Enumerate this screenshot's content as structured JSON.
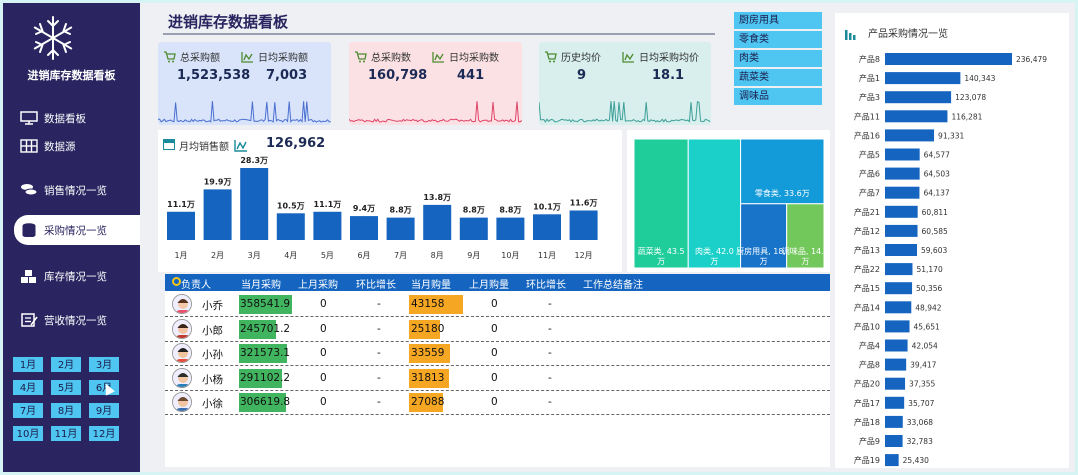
{
  "app": {
    "name": "进销库存数据看板",
    "title": "进销库存数据看板"
  },
  "sidebar": {
    "items": [
      {
        "label": "数据看板",
        "icon": "monitor-icon"
      },
      {
        "label": "数据源",
        "icon": "table-grid-icon"
      },
      {
        "label": "销售情况一览",
        "icon": "coins-icon"
      },
      {
        "label": "采购情况一览",
        "icon": "database-icon",
        "active": true
      },
      {
        "label": "库存情况一览",
        "icon": "boxes-icon"
      },
      {
        "label": "营收情况一览",
        "icon": "notepad-icon"
      }
    ],
    "months": [
      "1月",
      "2月",
      "3月",
      "4月",
      "5月",
      "6月",
      "7月",
      "8月",
      "9月",
      "10月",
      "11月",
      "12月"
    ]
  },
  "kpis": [
    {
      "label1": "总采购额",
      "value1": "1,523,538",
      "label2": "日均采购额",
      "value2": "7,003",
      "bg": "#d9e4fb",
      "spark": "#4a6fd0"
    },
    {
      "label1": "总采购数",
      "value1": "160,798",
      "label2": "日均采购数",
      "value2": "441",
      "bg": "#fbe1e4",
      "spark": "#e0446a"
    },
    {
      "label1": "历史均价",
      "value1": "9",
      "label2": "日均采购均价",
      "value2": "18.1",
      "bg": "#d8efed",
      "spark": "#3e9f99"
    }
  ],
  "categories": [
    "厨房用具",
    "零食类",
    "肉类",
    "蔬菜类",
    "调味品"
  ],
  "monthly": {
    "label": "月均销售额",
    "value": "126,962",
    "chart_data": {
      "type": "bar",
      "categories": [
        "1月",
        "2月",
        "3月",
        "4月",
        "5月",
        "6月",
        "7月",
        "8月",
        "9月",
        "10月",
        "11月",
        "12月"
      ],
      "values": [
        11.1,
        19.9,
        28.3,
        10.5,
        11.1,
        9.4,
        8.8,
        13.8,
        8.8,
        8.8,
        10.1,
        11.6
      ],
      "data_labels": [
        "11.1万",
        "19.9万",
        "28.3万",
        "10.5万",
        "11.1万",
        "9.4万",
        "8.8万",
        "13.8万",
        "8.8万",
        "8.8万",
        "10.1万",
        "11.6万"
      ],
      "color": "#1565c0"
    }
  },
  "treemap": {
    "chart_data": {
      "type": "treemap",
      "items": [
        {
          "name": "蔬菜类",
          "value": 43.5,
          "label": "蔬菜类, 43.5万",
          "color": "#1fcd9b"
        },
        {
          "name": "肉类",
          "value": 42.0,
          "label": "肉类, 42.0万",
          "color": "#1ad0c8"
        },
        {
          "name": "零食类",
          "value": 33.6,
          "label": "零食类, 33.6万",
          "color": "#139ad8"
        },
        {
          "name": "厨房用具",
          "value": 18.4,
          "label": "厨房用具, 18.4万",
          "color": "#1774c9"
        },
        {
          "name": "调味品",
          "value": 14.9,
          "label": "调味品, 14.9万",
          "color": "#72c85a"
        }
      ]
    }
  },
  "table": {
    "headers": [
      "负责人",
      "当月采购",
      "上月采购",
      "环比增长",
      "当月购量",
      "上月购量",
      "环比增长",
      "工作总结备注"
    ],
    "rows": [
      {
        "name": "小乔",
        "cur": "358541.9",
        "prev": "0",
        "growth": "-",
        "qty": "43158",
        "prevqty": "0",
        "qgrowth": "-",
        "g": 0.34,
        "o": 0.3
      },
      {
        "name": "小郎",
        "cur": "245701.2",
        "prev": "0",
        "growth": "-",
        "qty": "25180",
        "prevqty": "0",
        "qgrowth": "-",
        "g": 0.24,
        "o": 0.17
      },
      {
        "name": "小孙",
        "cur": "321573.1",
        "prev": "0",
        "growth": "-",
        "qty": "33559",
        "prevqty": "0",
        "qgrowth": "-",
        "g": 0.31,
        "o": 0.23
      },
      {
        "name": "小杨",
        "cur": "291102.2",
        "prev": "0",
        "growth": "-",
        "qty": "31813",
        "prevqty": "0",
        "qgrowth": "-",
        "g": 0.28,
        "o": 0.22
      },
      {
        "name": "小徐",
        "cur": "306619.8",
        "prev": "0",
        "growth": "-",
        "qty": "27088",
        "prevqty": "0",
        "qgrowth": "-",
        "g": 0.3,
        "o": 0.19
      }
    ]
  },
  "products": {
    "title": "产品采购情况一览",
    "chart_data": {
      "type": "bar",
      "orientation": "horizontal",
      "categories": [
        "产品8",
        "产品1",
        "产品3",
        "产品11",
        "产品16",
        "产品5",
        "产品6",
        "产品7",
        "产品21",
        "产品12",
        "产品13",
        "产品22",
        "产品15",
        "产品14",
        "产品10",
        "产品4",
        "产品8",
        "产品20",
        "产品17",
        "产品18",
        "产品9",
        "产品19"
      ],
      "values": [
        236479,
        140343,
        123078,
        116281,
        91331,
        64577,
        64503,
        64137,
        60811,
        60585,
        59603,
        51170,
        50356,
        48942,
        45651,
        42054,
        39417,
        37355,
        35707,
        33068,
        32783,
        25430
      ],
      "labels": [
        "236,479",
        "140,343",
        "123,078",
        "116,281",
        "91,331",
        "64,577",
        "64,503",
        "64,137",
        "60,811",
        "60,585",
        "59,603",
        "51,170",
        "50,356",
        "48,942",
        "45,651",
        "42,054",
        "39,417",
        "37,355",
        "35,707",
        "33,068",
        "32,783",
        "25,430"
      ],
      "xlim": [
        0,
        236479
      ],
      "color": "#1565c0"
    }
  }
}
